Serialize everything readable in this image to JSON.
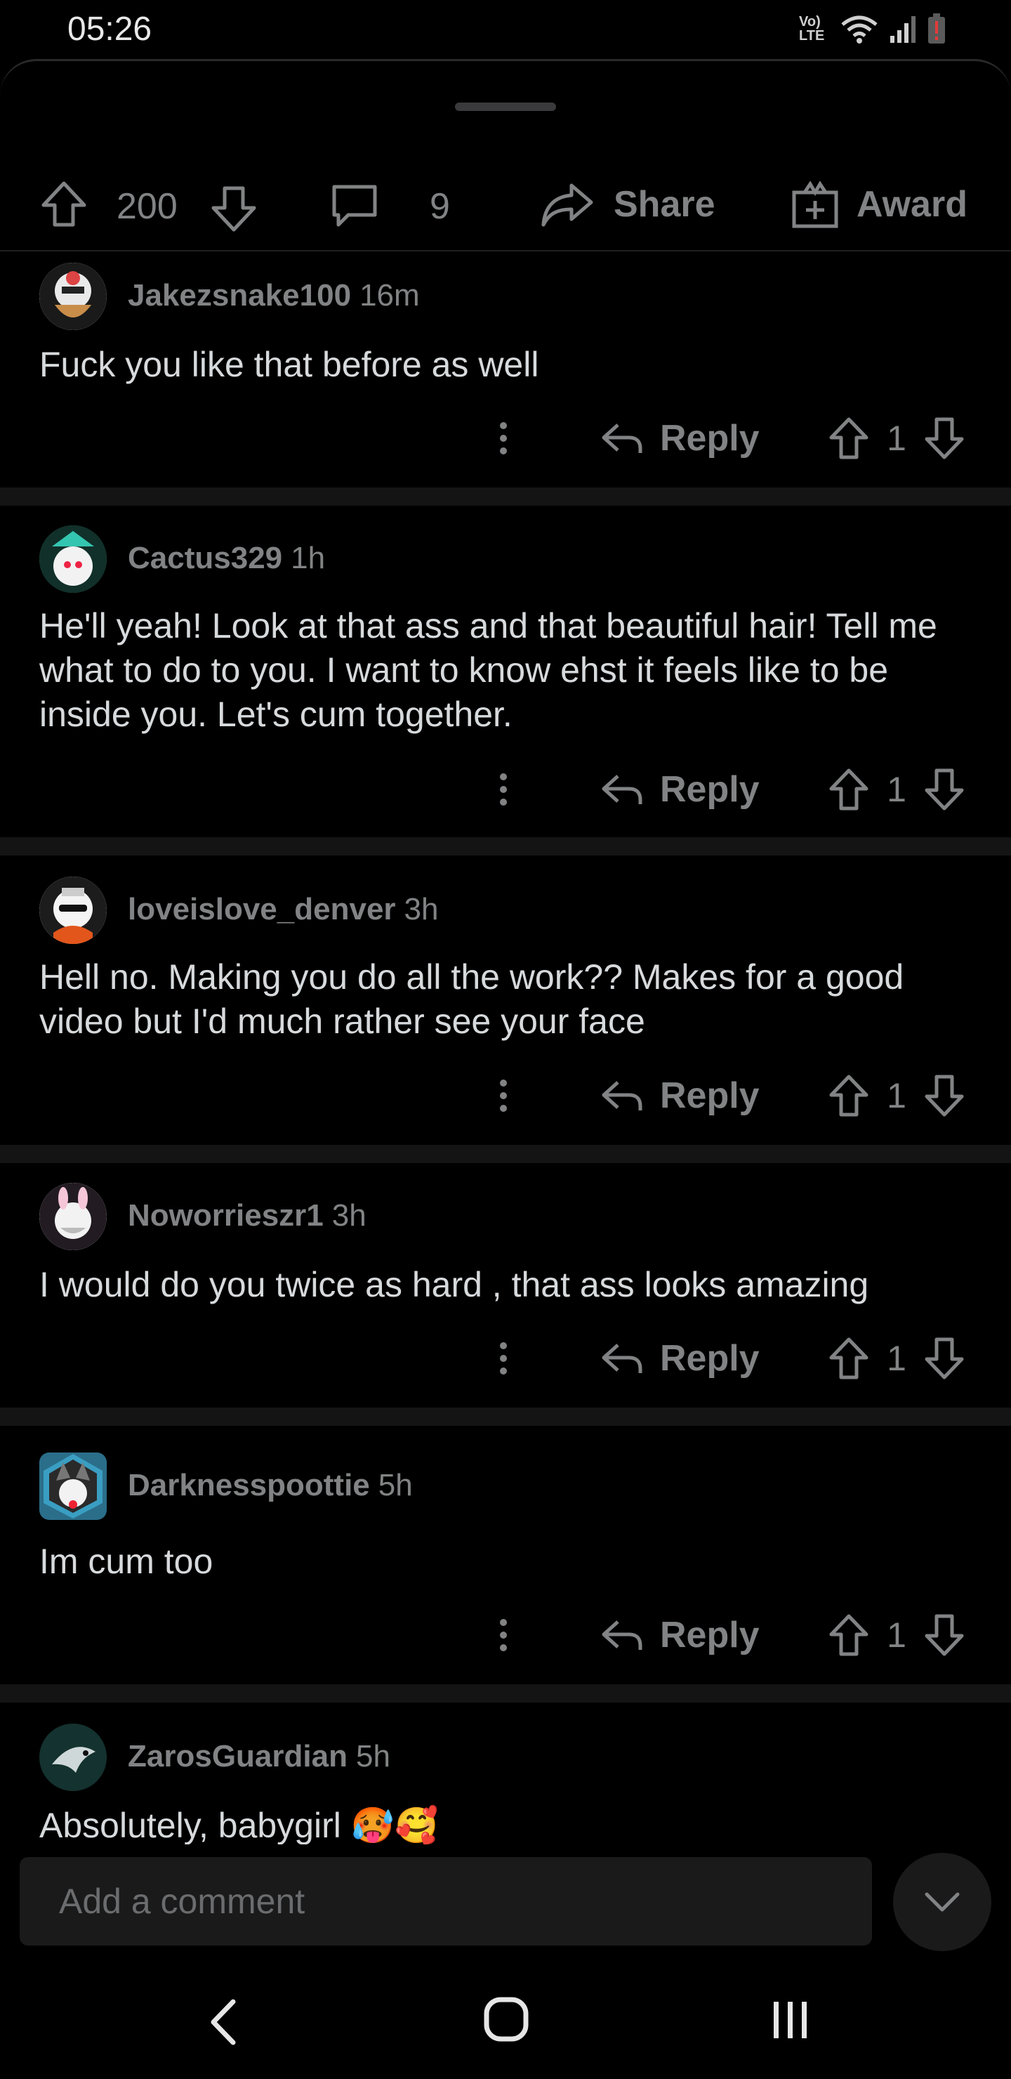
{
  "status_bar": {
    "time": "05:26",
    "network_label": "Vo) LTE"
  },
  "action_bar": {
    "upvotes": "200",
    "comments": "9",
    "share_label": "Share",
    "award_label": "Award"
  },
  "comments": [
    {
      "user": "Jakezsnake100",
      "time": "16m",
      "text": "Fuck you like that before as well",
      "reply_label": "Reply",
      "score": "1"
    },
    {
      "user": "Cactus329",
      "time": "1h",
      "text": "He'll yeah! Look at that ass and that beautiful hair! Tell me what to do to you. I want to know ehst it feels like to be inside you. Let's cum together.",
      "reply_label": "Reply",
      "score": "1"
    },
    {
      "user": "loveislove_denver",
      "time": "3h",
      "text": "Hell no. Making you do all the work?? Makes for a good video but I'd much rather see your face",
      "reply_label": "Reply",
      "score": "1"
    },
    {
      "user": "Noworrieszr1",
      "time": "3h",
      "text": "I would do you twice as hard , that ass looks amazing",
      "reply_label": "Reply",
      "score": "1"
    },
    {
      "user": "Darknesspoottie",
      "time": "5h",
      "text": "Im cum too",
      "reply_label": "Reply",
      "score": "1"
    },
    {
      "user": "ZarosGuardian",
      "time": "5h",
      "text": "Absolutely, babygirl 🥵🥰"
    }
  ],
  "comment_input": {
    "placeholder": "Add a comment"
  },
  "icons": {
    "upvote": "arrow-up-outline",
    "downvote": "arrow-down-outline",
    "comment": "speech-bubble",
    "share": "curved-arrow",
    "award": "gift-box",
    "reply": "reply-arrow",
    "more": "vertical-dots",
    "collapse": "chevron-down",
    "nav_back": "chevron-left",
    "nav_home": "rounded-square",
    "nav_recents": "three-bars"
  },
  "colors": {
    "background": "#000000",
    "text": "#d7dadc",
    "muted": "#818384",
    "surface": "#1a1a1b"
  }
}
